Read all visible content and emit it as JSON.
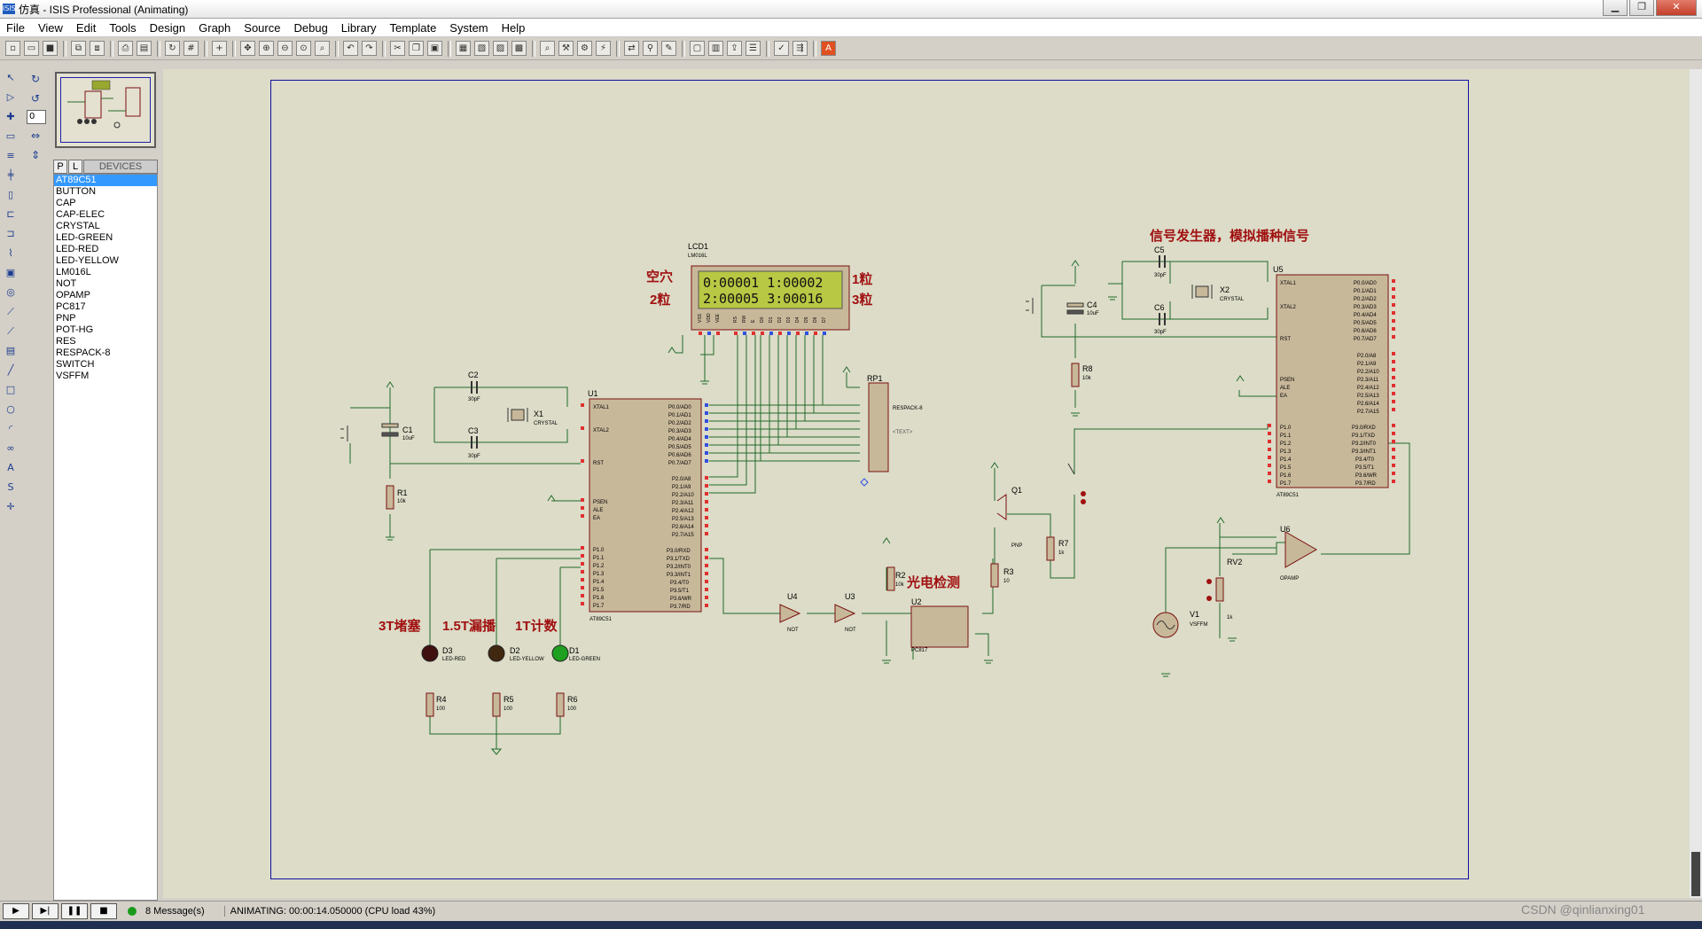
{
  "window": {
    "title": "仿真 - ISIS Professional (Animating)",
    "app_icon": "ISIS"
  },
  "menu": [
    "File",
    "View",
    "Edit",
    "Tools",
    "Design",
    "Graph",
    "Source",
    "Debug",
    "Library",
    "Template",
    "System",
    "Help"
  ],
  "rotation_value": "0",
  "device_tabs": {
    "p": "P",
    "l": "L",
    "title": "DEVICES"
  },
  "devices": [
    "AT89C51",
    "BUTTON",
    "CAP",
    "CAP-ELEC",
    "CRYSTAL",
    "LED-GREEN",
    "LED-RED",
    "LED-YELLOW",
    "LM016L",
    "NOT",
    "OPAMP",
    "PC817",
    "PNP",
    "POT-HG",
    "RES",
    "RESPACK-8",
    "SWITCH",
    "VSFFM"
  ],
  "selected_device": "AT89C51",
  "schematic": {
    "lcd": {
      "ref": "LCD1",
      "part": "LM016L",
      "line1": "0:00001  1:00002",
      "line2": "2:00005  3:00016"
    },
    "labels": {
      "kongxue": "空穴",
      "liang1": "1粒",
      "liang2": "2粒",
      "liang3": "3粒",
      "signal_gen": "信号发生器，模拟播种信号",
      "photo_detect": "光电检测",
      "d3_label": "3T堵塞",
      "d2_label": "1.5T漏播",
      "d1_label": "1T计数"
    },
    "parts": {
      "u1": "U1",
      "u1_part": "AT89C51",
      "u5": "U5",
      "u5_part": "AT89C51",
      "rp1": "RP1",
      "rp1_part": "RESPACK-8",
      "c1": "C1",
      "c1_val": "10uF",
      "c2": "C2",
      "c2_val": "30pF",
      "c3": "C3",
      "c3_val": "30pF",
      "c4": "C4",
      "c4_val": "10uF",
      "c5": "C5",
      "c5_val": "30pF",
      "c6": "C6",
      "c6_val": "30pF",
      "x1": "X1",
      "x1_part": "CRYSTAL",
      "x2": "X2",
      "x2_part": "CRYSTAL",
      "r1": "R1",
      "r1_val": "10k",
      "r2": "R2",
      "r2_val": "10k",
      "r3": "R3",
      "r3_val": "10",
      "r4": "R4",
      "r4_val": "100",
      "r5": "R5",
      "r5_val": "100",
      "r6": "R6",
      "r6_val": "100",
      "r7": "R7",
      "r7_val": "1k",
      "r8": "R8",
      "r8_val": "10k",
      "rv2": "RV2",
      "rv2_val": "1k",
      "q1": "Q1",
      "q1_part": "PNP",
      "u2": "U2",
      "u2_part": "PC817",
      "u3": "U3",
      "u3_part": "NOT",
      "u4": "U4",
      "u4_part": "NOT",
      "u6": "U6",
      "u6_part": "OPAMP",
      "v1": "V1",
      "v1_part": "VSFFM",
      "d1": "D1",
      "d1_part": "LED-GREEN",
      "d2": "D2",
      "d2_part": "LED-YELLOW",
      "d3": "D3",
      "d3_part": "LED-RED",
      "text_placeholder": "<TEXT>"
    },
    "mcu_pins_left": [
      "XTAL1",
      "XTAL2",
      "RST",
      "PSEN",
      "ALE",
      "EA",
      "P1.0",
      "P1.1",
      "P1.2",
      "P1.3",
      "P1.4",
      "P1.5",
      "P1.6",
      "P1.7"
    ],
    "mcu_pins_right": [
      "P0.0/AD0",
      "P0.1/AD1",
      "P0.2/AD2",
      "P0.3/AD3",
      "P0.4/AD4",
      "P0.5/AD5",
      "P0.6/AD6",
      "P0.7/AD7",
      "P2.0/A8",
      "P2.1/A9",
      "P2.2/A10",
      "P2.3/A11",
      "P2.4/A12",
      "P2.5/A13",
      "P2.6/A14",
      "P2.7/A15",
      "P3.0/RXD",
      "P3.1/TXD",
      "P3.2/INT0",
      "P3.3/INT1",
      "P3.4/T0",
      "P3.5/T1",
      "P3.6/WR",
      "P3.7/RD"
    ],
    "lcd_pins": [
      "VSS",
      "VDD",
      "VEE",
      "RS",
      "RW",
      "E",
      "D0",
      "D1",
      "D2",
      "D3",
      "D4",
      "D5",
      "D6",
      "D7"
    ]
  },
  "status": {
    "messages": "8 Message(s)",
    "animating": "ANIMATING: 00:00:14.050000 (CPU load 43%)"
  },
  "watermark": "CSDN @qinlianxing01"
}
